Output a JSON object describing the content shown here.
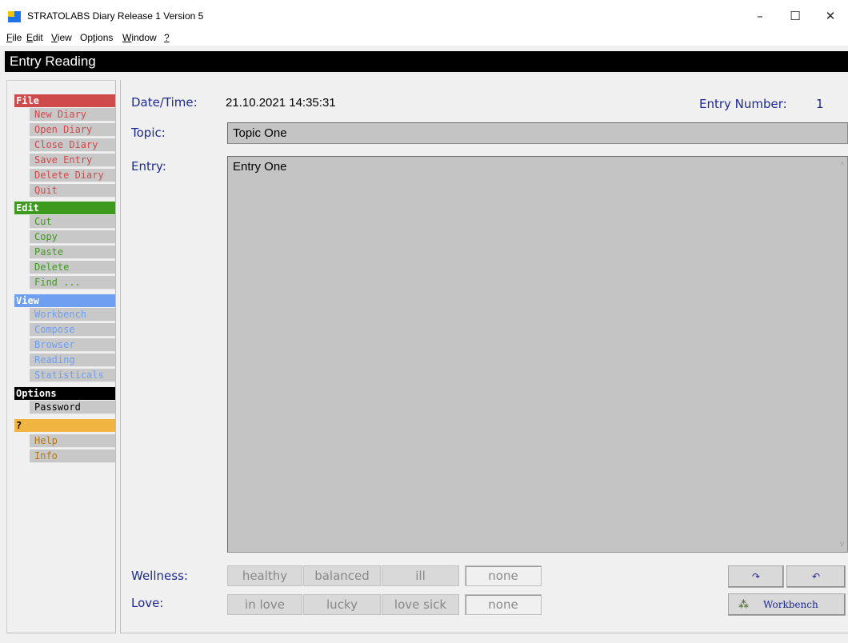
{
  "window": {
    "title": "STRATOLABS Diary Release 1 Version 5",
    "minimize": "–",
    "maximize": "☐",
    "close": "✕"
  },
  "menu": [
    {
      "underline": "F",
      "rest": "ile"
    },
    {
      "underline": "E",
      "rest": "dit"
    },
    {
      "underline": "V",
      "rest": "iew"
    },
    {
      "pre": "Op",
      "underline": "t",
      "rest": "ions"
    },
    {
      "underline": "W",
      "rest": "indow"
    },
    {
      "underline": "?",
      "rest": ""
    }
  ],
  "header": {
    "title": "Entry Reading"
  },
  "nav": {
    "file": {
      "title": "File",
      "items": [
        "New Diary",
        "Open Diary",
        "Close Diary",
        "Save Entry",
        "Delete Diary",
        "Quit"
      ]
    },
    "edit": {
      "title": "Edit",
      "items": [
        "Cut",
        "Copy",
        "Paste",
        "Delete",
        "Find ..."
      ]
    },
    "view": {
      "title": "View",
      "items": [
        "Workbench",
        "Compose",
        "Browser",
        "Reading",
        "Statisticals"
      ]
    },
    "options": {
      "title": "Options",
      "items": [
        "Password"
      ]
    },
    "help": {
      "title": "?",
      "items": [
        "Help",
        "Info"
      ]
    }
  },
  "main": {
    "datetime_label": "Date/Time:",
    "datetime_value": "21.10.2021 14:35:31",
    "entry_number_label": "Entry Number:",
    "entry_number_value": "1",
    "topic_label": "Topic:",
    "topic_value": "Topic One",
    "entry_label": "Entry:",
    "entry_value": "Entry One",
    "wellness_label": "Wellness:",
    "wellness_options": [
      "healthy",
      "balanced",
      "ill",
      "none"
    ],
    "love_label": "Love:",
    "love_options": [
      "in love",
      "lucky",
      "love sick",
      "none"
    ],
    "selected_wellness": "none",
    "selected_love": "none",
    "redo_icon": "↷",
    "undo_icon": "↶",
    "workbench_icon": "⁂",
    "workbench_label": "Workbench"
  },
  "colors": {
    "file": "#cf4a4a",
    "edit": "#3e9a1f",
    "view": "#6e9ff0",
    "options": "#000000",
    "help": "#f0b440",
    "label": "#1e2a90"
  }
}
